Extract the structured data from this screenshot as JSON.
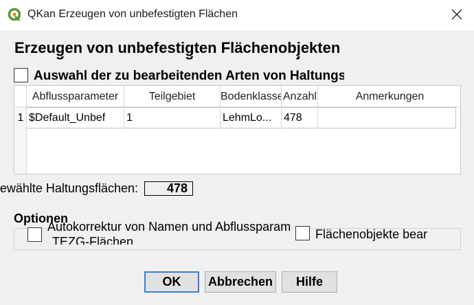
{
  "window": {
    "title": "QKan Erzeugen von unbefestigten Flächen",
    "app_icon": "qgis-icon",
    "close_icon": "close-icon"
  },
  "heading": "Erzeugen von unbefestigten Flächenobjekten",
  "auswahl": {
    "checked": false,
    "label": "Auswahl der zu bearbeitenden Arten von Haltungsflächen"
  },
  "table": {
    "columns": [
      "Abflussparameter",
      "Teilgebiet",
      "Bodenklasse",
      "Anzahl",
      "Anmerkungen"
    ],
    "rows": [
      {
        "num": "1",
        "cells": [
          "$Default_Unbef",
          "1",
          "LehmLo...",
          "478",
          ""
        ]
      }
    ]
  },
  "count": {
    "label": "Anzahl gewählte Haltungsflächen:",
    "value": "478"
  },
  "options": {
    "title": "Optionen",
    "autokorrektur": {
      "checked": false,
      "label": "Autokorrektur von Namen und Abflussparametern in TEZG-Flächen",
      "label_line1": "Autokorrektur von Namen und Abflussparametern in",
      "label_line2": "TEZG-Flächen"
    },
    "flaechenobjekte": {
      "checked": false,
      "label": "Flächenobjekte bearbeiten"
    }
  },
  "buttons": {
    "ok": "OK",
    "cancel": "Abbrechen",
    "help": "Hilfe"
  },
  "colors": {
    "qgis_green": "#589632",
    "qgis_yellow": "#ee7913",
    "default_button_border": "#3c7fd0"
  }
}
